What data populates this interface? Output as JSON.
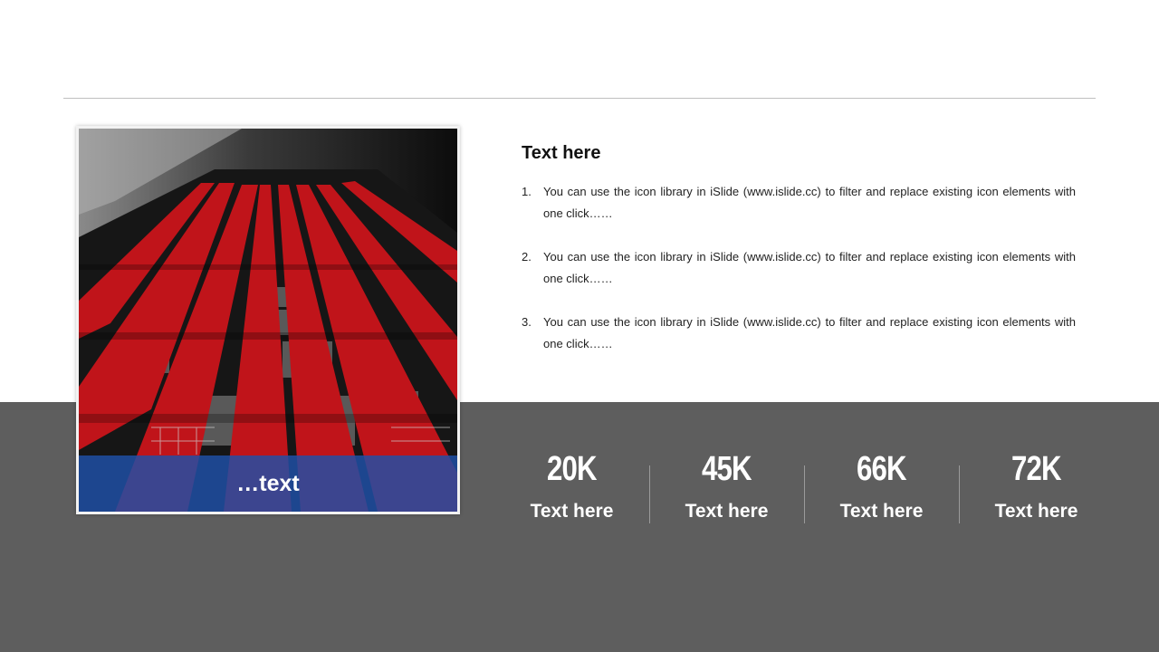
{
  "photo": {
    "caption": "…text"
  },
  "content": {
    "title": "Text here",
    "items": [
      {
        "num": "1.",
        "text": "You can use the icon library in iSlide  (www.islide.cc) to filter and replace existing icon elements with one click……"
      },
      {
        "num": "2.",
        "text": "You can use the icon library in iSlide  (www.islide.cc) to filter and replace existing icon elements with one click……"
      },
      {
        "num": "3.",
        "text": "You can use the icon library in iSlide  (www.islide.cc) to filter and replace existing icon elements with one click……"
      }
    ]
  },
  "stats": [
    {
      "value": "20K",
      "label": "Text here"
    },
    {
      "value": "45K",
      "label": "Text here"
    },
    {
      "value": "66K",
      "label": "Text here"
    },
    {
      "value": "72K",
      "label": "Text here"
    }
  ],
  "colors": {
    "band": "#5e5e5e",
    "caption_bar": "#1e50aa",
    "building_red": "#c0141a"
  }
}
